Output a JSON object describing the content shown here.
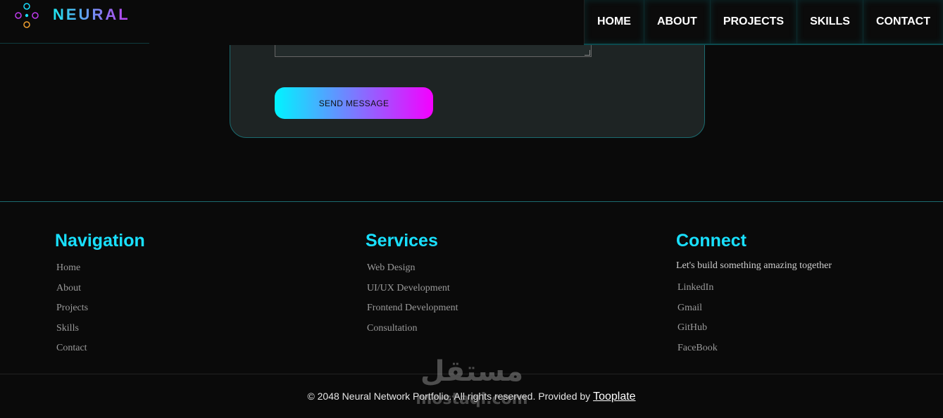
{
  "header": {
    "logo_text": "NEURAL",
    "nav": [
      "HOME",
      "ABOUT",
      "PROJECTS",
      "SKILLS",
      "CONTACT"
    ]
  },
  "contact_form": {
    "message_value": "",
    "send_label": "SEND MESSAGE"
  },
  "footer": {
    "navigation": {
      "title": "Navigation",
      "links": [
        "Home",
        "About",
        "Projects",
        "Skills",
        "Contact"
      ]
    },
    "services": {
      "title": "Services",
      "links": [
        "Web Design",
        "UI/UX Development",
        "Frontend Development",
        "Consultation"
      ]
    },
    "connect": {
      "title": "Connect",
      "tagline": "Let's build something amazing together",
      "links": [
        "LinkedIn",
        "Gmail",
        "GitHub",
        "FaceBook"
      ]
    },
    "copyright": "© 2048 Neural Network Portfolio. All rights reserved. Provided by",
    "provider_link": "Tooplate"
  },
  "watermark": {
    "arabic": "مستقل",
    "latin": "mostaql.com"
  },
  "colors": {
    "accent_cyan": "#19e0ff",
    "accent_magenta": "#f500ff",
    "background": "#0a0a0a"
  }
}
